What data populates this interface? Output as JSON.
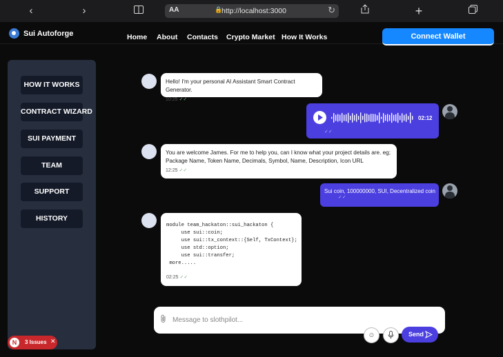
{
  "browser": {
    "text_size_label": "AA",
    "url": "http://localhost:3000"
  },
  "header": {
    "brand": "Sui Autoforge",
    "nav": [
      "Home",
      "About",
      "Contacts",
      "Crypto Market",
      "How It Works"
    ],
    "connect_label": "Connect Wallet"
  },
  "sidebar": {
    "items": [
      "HOW IT WORKS",
      "CONTRACT WIZARD",
      "SUI PAYMENT",
      "TEAM",
      "SUPPORT",
      "HISTORY"
    ]
  },
  "messages": [
    {
      "from": "bot",
      "text": "Hello! I'm your personal AI Assistant Smart Contract Generator.",
      "time": "10:25"
    },
    {
      "from": "user",
      "kind": "voice",
      "duration": "02:12"
    },
    {
      "from": "bot",
      "text_1": "You are welcome James. For me to help you, can I know what your project details are. eg;",
      "text_2": "Package Name, Token Name, Decimals, Symbol, Name, Description, Icon URL",
      "time": "12:25"
    },
    {
      "from": "user",
      "text": "Sui coin, 100000000, SUI, Decentralized coin"
    },
    {
      "from": "bot",
      "kind": "code",
      "code": "module team_hackaton::sui_hackaton {\n     use sui::coin;\n     use sui::tx_context::{Self, TxContext};\n     use std::option;\n     use sui::transfer;\n more.....",
      "time": "02:25"
    }
  ],
  "composer": {
    "placeholder": "Message to slothpilot...",
    "send_label": "Send"
  },
  "issues": {
    "letter": "N",
    "label": "3 Issues"
  }
}
